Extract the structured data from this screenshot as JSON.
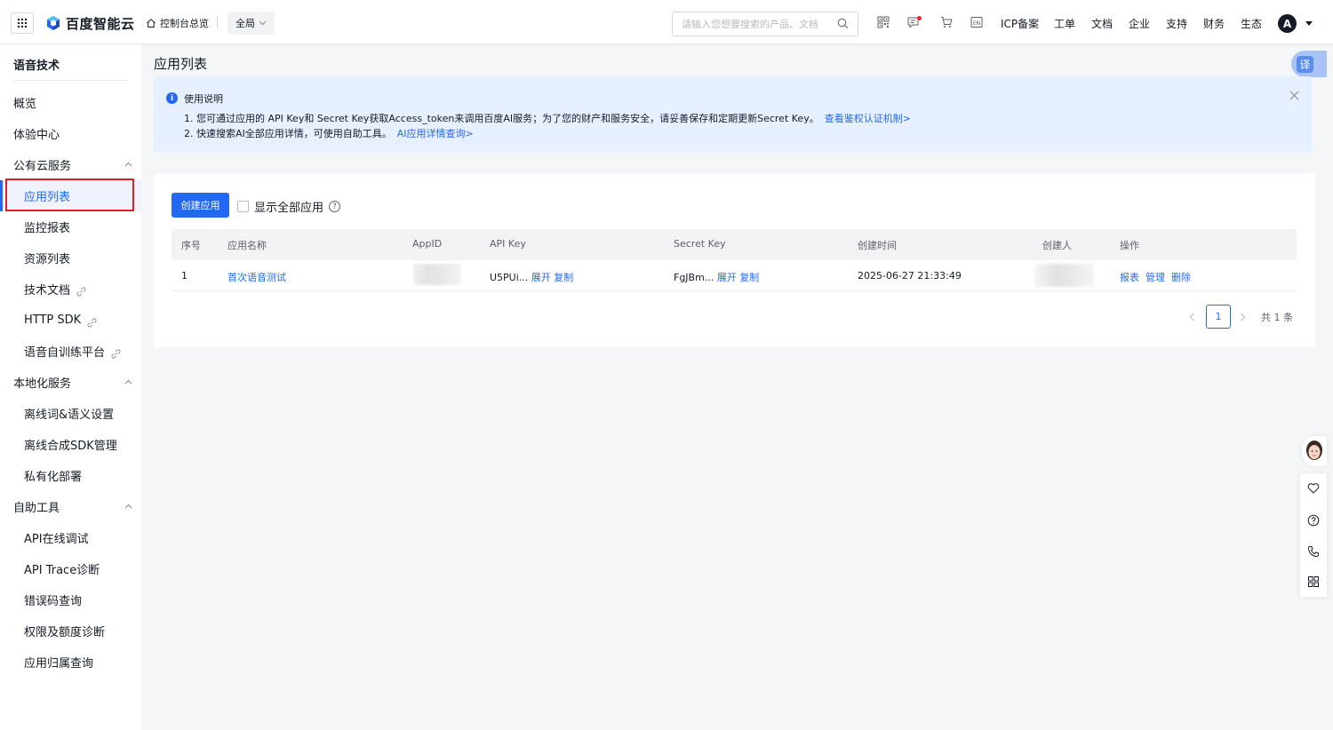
{
  "topbar": {
    "brand": "百度智能云",
    "console_label": "控制台总览",
    "region": "全局",
    "search_placeholder": "请输入您想要搜索的产品、文档",
    "links": [
      "ICP备案",
      "工单",
      "文档",
      "企业",
      "支持",
      "财务",
      "生态"
    ],
    "avatar_letter": "A"
  },
  "sidebar": {
    "title": "语音技术",
    "items": [
      {
        "label": "概览",
        "level": "top"
      },
      {
        "label": "体验中心",
        "level": "top"
      },
      {
        "label": "公有云服务",
        "level": "top",
        "group": true
      },
      {
        "label": "应用列表",
        "level": "sub",
        "active": true
      },
      {
        "label": "监控报表",
        "level": "sub"
      },
      {
        "label": "资源列表",
        "level": "sub"
      },
      {
        "label": "技术文档",
        "level": "sub",
        "external": true
      },
      {
        "label": "HTTP SDK",
        "level": "sub",
        "external": true
      },
      {
        "label": "语音自训练平台",
        "level": "sub",
        "external": true
      },
      {
        "label": "本地化服务",
        "level": "top",
        "group": true
      },
      {
        "label": "离线词&语义设置",
        "level": "sub"
      },
      {
        "label": "离线合成SDK管理",
        "level": "sub"
      },
      {
        "label": "私有化部署",
        "level": "sub"
      },
      {
        "label": "自助工具",
        "level": "top",
        "group": true
      },
      {
        "label": "API在线调试",
        "level": "sub"
      },
      {
        "label": "API Trace诊断",
        "level": "sub"
      },
      {
        "label": "错误码查询",
        "level": "sub"
      },
      {
        "label": "权限及额度诊断",
        "level": "sub"
      },
      {
        "label": "应用归属查询",
        "level": "sub"
      }
    ]
  },
  "main": {
    "page_title": "应用列表",
    "translate_label": "译",
    "notice": {
      "title": "使用说明",
      "line1": "1. 您可通过应用的 API Key和 Secret Key获取Access_token来调用百度AI服务；为了您的财产和服务安全，请妥善保存和定期更新Secret Key。",
      "line1_link": "查看鉴权认证机制>",
      "line2": "2. 快速搜索AI全部应用详情，可使用自助工具。",
      "line2_link": "AI应用详情查询>"
    },
    "create_button": "创建应用",
    "show_all_label": "显示全部应用",
    "table": {
      "headers": [
        "序号",
        "应用名称",
        "AppID",
        "API Key",
        "Secret Key",
        "创建时间",
        "创建人",
        "操作"
      ],
      "rows": [
        {
          "index": "1",
          "name": "首次语音测试",
          "api_key": "U5PUi...",
          "secret_key": "FgJBm...",
          "expand": "展开",
          "copy": "复制",
          "created": "2025-06-27 21:33:49",
          "actions": [
            "报表",
            "管理",
            "删除"
          ]
        }
      ]
    },
    "pagination": {
      "current_page": "1",
      "total": "共 1 条"
    }
  },
  "colors": {
    "accent": "#2468f2",
    "notice_bg": "#e6f0ff",
    "highlight_border": "#e02020"
  }
}
